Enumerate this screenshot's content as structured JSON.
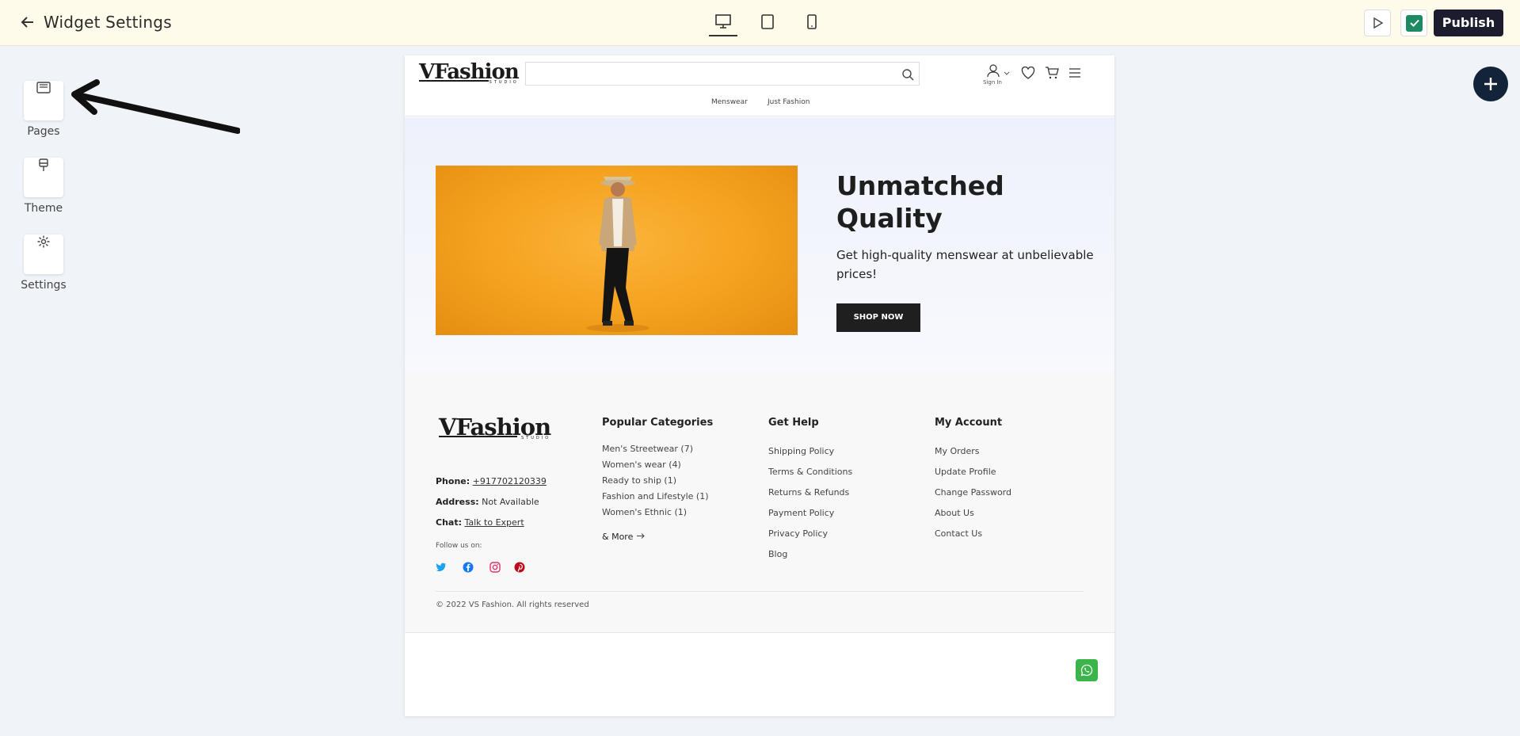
{
  "topbar": {
    "title": "Widget Settings",
    "publish_label": "Publish"
  },
  "rail": {
    "items": [
      {
        "label": "Pages",
        "icon": "pages-icon"
      },
      {
        "label": "Theme",
        "icon": "brush-icon"
      },
      {
        "label": "Settings",
        "icon": "gear-icon"
      }
    ]
  },
  "site": {
    "header": {
      "signin": "Sign In",
      "nav": [
        "Menswear",
        "Just Fashion"
      ]
    },
    "hero": {
      "title_line1": "Unmatched",
      "title_line2": "Quality",
      "subtitle": "Get high-quality menswear at unbelievable prices!",
      "button": "SHOP NOW"
    },
    "footer": {
      "phone_label": "Phone:",
      "phone": "+917702120339",
      "address_label": "Address:",
      "address": "Not Available",
      "chat_label": "Chat:",
      "chat": "Talk to Expert",
      "follow": "Follow us on:",
      "columns": [
        {
          "title": "Popular Categories",
          "links": [
            "Men's Streetwear (7)",
            "Women's wear (4)",
            "Ready to ship (1)",
            "Fashion and Lifestyle (1)",
            "Women's Ethnic (1)"
          ],
          "more": "& More"
        },
        {
          "title": "Get Help",
          "links": [
            "Shipping Policy",
            "Terms & Conditions",
            "Returns & Refunds",
            "Payment Policy",
            "Privacy Policy",
            "Blog"
          ]
        },
        {
          "title": "My Account",
          "links": [
            "My Orders",
            "Update Profile",
            "Change Password",
            "About Us",
            "Contact Us"
          ]
        }
      ],
      "copyright": "© 2022 VS Fashion. All rights reserved"
    }
  },
  "colors": {
    "topbar_bg": "#fffbeb",
    "publish_bg": "#1c1c2e",
    "check_green": "#1e8a63",
    "hero_orange": "#f5a320",
    "whatsapp_green": "#3bb54a"
  }
}
